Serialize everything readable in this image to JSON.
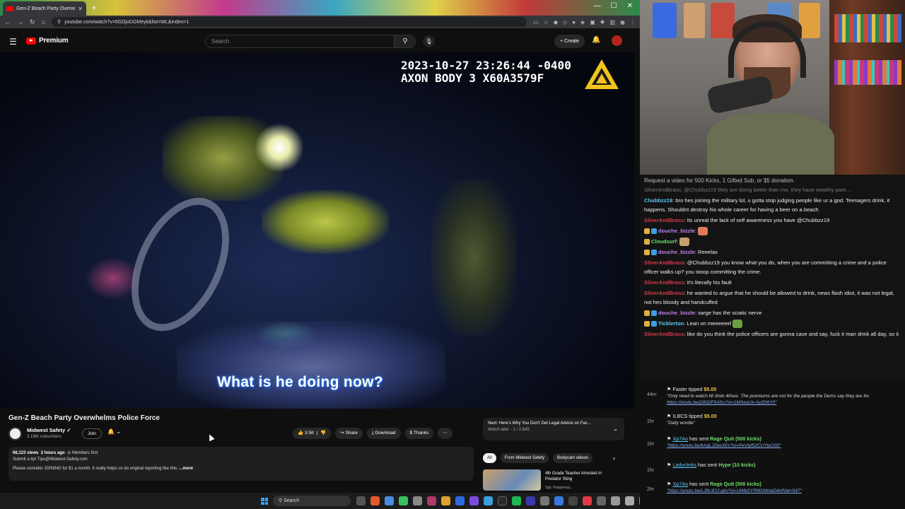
{
  "browser": {
    "tab_title": "Gen-Z Beach Party Overwhelms",
    "url": "youtube.com/watch?v=6GDjoDGMeyk&list=WL&index=1"
  },
  "header": {
    "brand": "Premium",
    "search_placeholder": "Search",
    "create_label": "Create"
  },
  "video": {
    "timestamp_line1": "2023-10-27 23:26:44 -0400",
    "timestamp_line2": "AXON BODY 3 X60A3579F",
    "caption": "What is he doing now?",
    "title": "Gen-Z Beach Party Overwhelms Police Force"
  },
  "channel": {
    "name": "Midwest Safety",
    "subscribers": "3.18M subscribers",
    "join_label": "Join"
  },
  "actions": {
    "likes": "3.5K",
    "share": "Share",
    "download": "Download",
    "thanks": "Thanks"
  },
  "description": {
    "views": "66,123 views",
    "age": "2 hours ago",
    "members": "Members first",
    "line1": "Submit a tip! Tips@Midwest-Safety.com",
    "line2": "Please consider JOINING for $1 a month. It really helps us do original reporting like this.",
    "more": "...more"
  },
  "queue": {
    "next": "Next: Here's Why You Don't Get Legal Advice on Fac...",
    "sub": "Watch later - 1 / 2,845"
  },
  "chips": [
    "All",
    "From Midwest Safety",
    "Bodycam videos"
  ],
  "recommendation": {
    "title": "4th Grade Teacher Arrested in Predator Sting",
    "channel": "Sgt. Peppersp..."
  },
  "taskbar": {
    "search": "Search"
  },
  "chat": {
    "banner": "Request a video for 500 Kicks, 1 Gifted Sub, or $5 donation.",
    "faded": "SilverAndBrass: @Chubbzz19 they are doing better than me, they have wealthy pare...",
    "messages": [
      {
        "user": "Chubbzz19",
        "text": ": bro hes joining the military lol, u gotta stop judging people like ur a god. Teenagers drink, it happens. Shouldnt destroy his whole career for having a beer on a beach",
        "color": "#5ec8f8",
        "badges": 0
      },
      {
        "user": "SilverAndBrass",
        "text": ": its unreal the lack of self awareness you have @Chubbzz19",
        "color": "#d83a4a",
        "badges": 0
      },
      {
        "user": "douche_bizzle",
        "text": ":",
        "color": "#c080f0",
        "badges": 2,
        "emote": "#e07a5a"
      },
      {
        "user": "Cloudsurf",
        "text": ":",
        "color": "#6fe06a",
        "badges": 1,
        "emote": "#c8a070"
      },
      {
        "user": "douche_bizzle",
        "text": ": Reeelax",
        "color": "#c080f0",
        "badges": 2
      },
      {
        "user": "SilverAndBrass",
        "text": ": @Chubbzz19 you know what you do, when you are committing a crime and a police officer walks up? you stoop committing the crime.",
        "color": "#d83a4a",
        "badges": 0
      },
      {
        "user": "SilverAndBrass",
        "text": ": it's literally his fault",
        "color": "#d83a4a",
        "badges": 0
      },
      {
        "user": "SilverAndBrass",
        "text": ": he wanted to argue that he should be allowed to drink, news flash idiot, it was not legal, not hes bloody and handcuffed",
        "color": "#d83a4a",
        "badges": 0
      },
      {
        "user": "douche_bizzle",
        "text": ": sarge has the sciatic nerve",
        "color": "#c080f0",
        "badges": 2
      },
      {
        "user": "Ticklerton",
        "text": ": Lean on meeeeeel",
        "color": "#5ec8f8",
        "badges": 2,
        "emote": "#6aa040"
      },
      {
        "user": "SilverAndBrass",
        "text": ": like do you think the police officers are gonna cave and say, fuck it man drink all day, so it",
        "color": "#d83a4a",
        "badges": 0
      }
    ]
  },
  "events": [
    {
      "time": "44m",
      "line": "Faster tipped $5.00",
      "sub": "\"Only need to watch till 3min 40sec. The premiums are not for the people the Dems say they are for.",
      "link": "https://youtu.be/j2832P5Afss?si=1MSerpJv-hy2D6Y0\""
    },
    {
      "time": "1hr",
      "line": "ILBCS tipped $5.00",
      "sub": "\"Daily wordle\""
    },
    {
      "time": "1hr",
      "name": "Xp7Ao",
      "line": "has sent",
      "hl": "Rage Quit (500 kicks)",
      "link": "\"https://youtu.be/kAqLJZeeXEc?si=PeVlyf52CUYteO02\""
    },
    {
      "time": "1hr",
      "name": "Ladyclinks",
      "line": "has sent",
      "hl": "Hype (10 kicks)"
    },
    {
      "time": "2hr",
      "name": "Xp7Ao",
      "line": "has sent",
      "hl": "Rage Quit (500 kicks)",
      "link": "\"https://youtu.be/LJftc3OJ-gko?si=UWbSYRMXMnlaD4ofVat=547\""
    }
  ],
  "colors": {
    "youtube_red": "#ff0000",
    "chat_red": "#d83a4a",
    "chat_blue": "#5ec8f8",
    "chat_purple": "#c080f0",
    "kick_green": "#6fe06a"
  }
}
